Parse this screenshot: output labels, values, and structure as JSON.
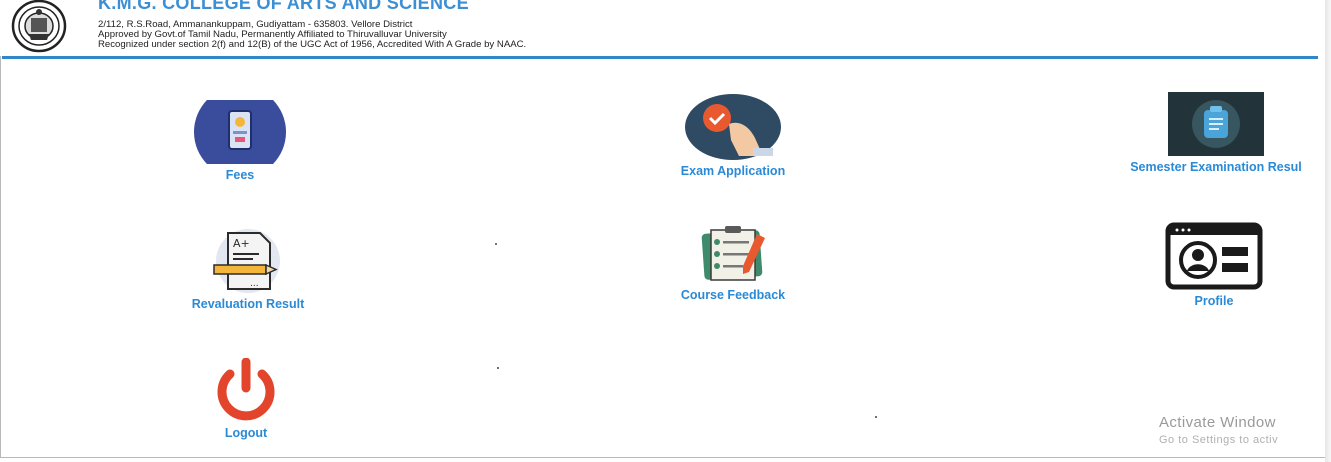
{
  "header": {
    "college_name": "K.M.G. COLLEGE OF ARTS AND SCIENCE",
    "address": "2/112, R.S.Road, Ammanankuppam, Gudiyattam - 635803. Vellore District",
    "approval": "Approved by Govt.of Tamil Nadu, Permanently Affiliated to Thiruvalluvar University",
    "recognition": "Recognized under section 2(f) and 12(B) of the UGC Act of 1956, Accredited With A Grade by NAAC."
  },
  "menu": {
    "fees": "Fees",
    "exam_application": "Exam Application",
    "semester_result": "Semester Examination Resul",
    "revaluation_result": "Revaluation Result",
    "course_feedback": "Course Feedback",
    "profile": "Profile",
    "logout": "Logout"
  },
  "watermark": {
    "line1": "Activate Window",
    "line2": "Go to Settings to activ"
  },
  "colors": {
    "accent": "#2a8ad6",
    "header_line": "#2f86c9",
    "title": "#3c8fd3",
    "logout_red": "#e2452b",
    "fees_circle": "#3a4c9c",
    "exam_circle": "#2f4a63"
  }
}
